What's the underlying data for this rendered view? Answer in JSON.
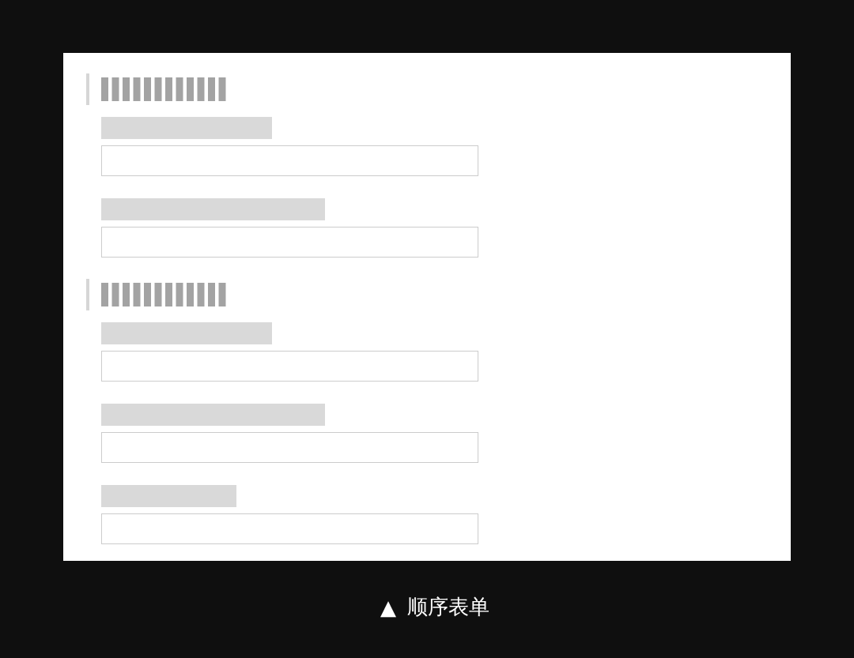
{
  "form": {
    "sections": [
      {
        "heading": {
          "kind": "placeholder"
        },
        "fields": [
          {
            "kind": "text-input"
          },
          {
            "kind": "text-input"
          }
        ]
      },
      {
        "heading": {
          "kind": "placeholder"
        },
        "fields": [
          {
            "kind": "text-input"
          },
          {
            "kind": "text-input"
          },
          {
            "kind": "text-input"
          }
        ]
      }
    ]
  },
  "caption": {
    "marker": "▲",
    "text": "顺序表单"
  }
}
